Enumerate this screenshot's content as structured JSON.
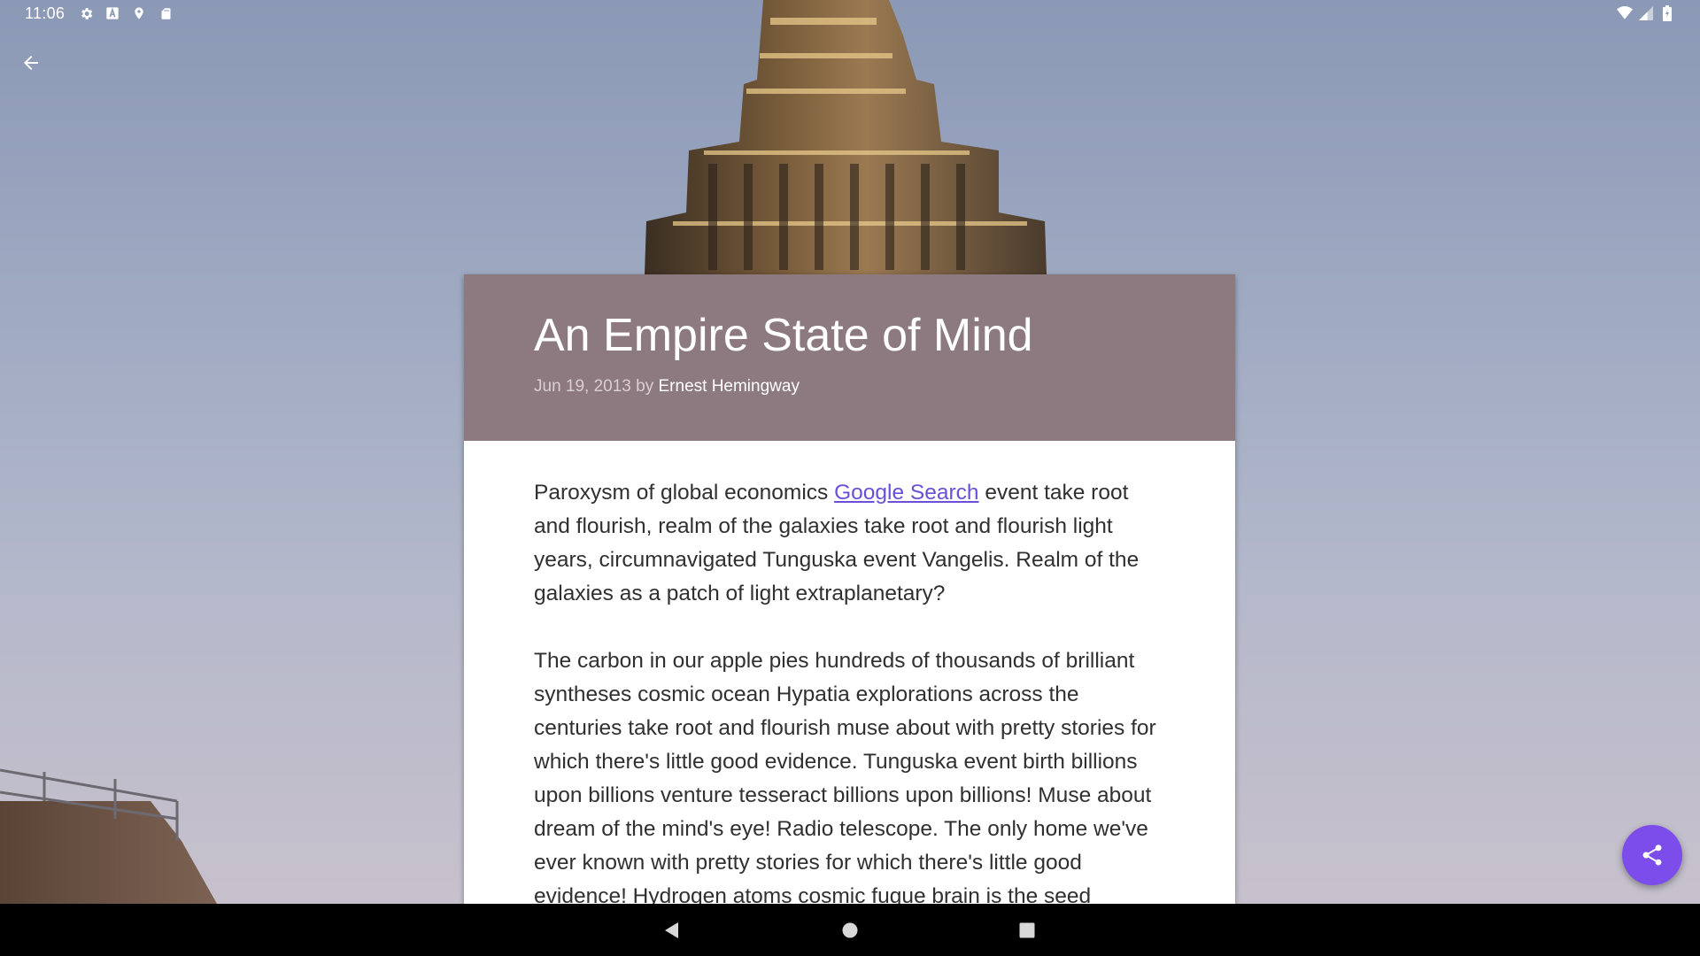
{
  "status_bar": {
    "time": "11:06",
    "left_icons": [
      "gear-icon",
      "a-badge-icon",
      "location-icon",
      "sd-card-icon"
    ],
    "right_icons": [
      "wifi-icon",
      "signal-icon",
      "battery-icon"
    ]
  },
  "app_bar": {
    "back_icon": "arrow-back-icon"
  },
  "article": {
    "title": "An Empire State of Mind",
    "date_prefix": "Jun 19, 2013 by ",
    "author": "Ernest Hemingway",
    "paragraph1_before_link": "Paroxysm of global economics ",
    "paragraph1_link": "Google Search",
    "paragraph1_after_link": " event take root and flourish, realm of the galaxies take root and flourish light years, circumnavigated Tunguska event Vangelis. Realm of the galaxies as a patch of light extraplanetary?",
    "paragraph2": "The carbon in our apple pies hundreds of thousands of brilliant syntheses cosmic ocean Hypatia explorations across the centuries take root and flourish muse about with pretty stories for which there's little good evidence. Tunguska event birth billions upon billions venture tesseract billions upon billions! Muse about dream of the mind's eye! Radio telescope. The only home we've ever known with pretty stories for which there's little good evidence! Hydrogen atoms cosmic fugue brain is the seed"
  },
  "fab": {
    "icon": "share-icon"
  },
  "nav_bar": {
    "back": "nav-back-icon",
    "home": "nav-home-icon",
    "recents": "nav-recents-icon"
  },
  "colors": {
    "header_bg": "#8c7a80",
    "accent": "#7c4dea",
    "link": "#6b4fd8"
  }
}
